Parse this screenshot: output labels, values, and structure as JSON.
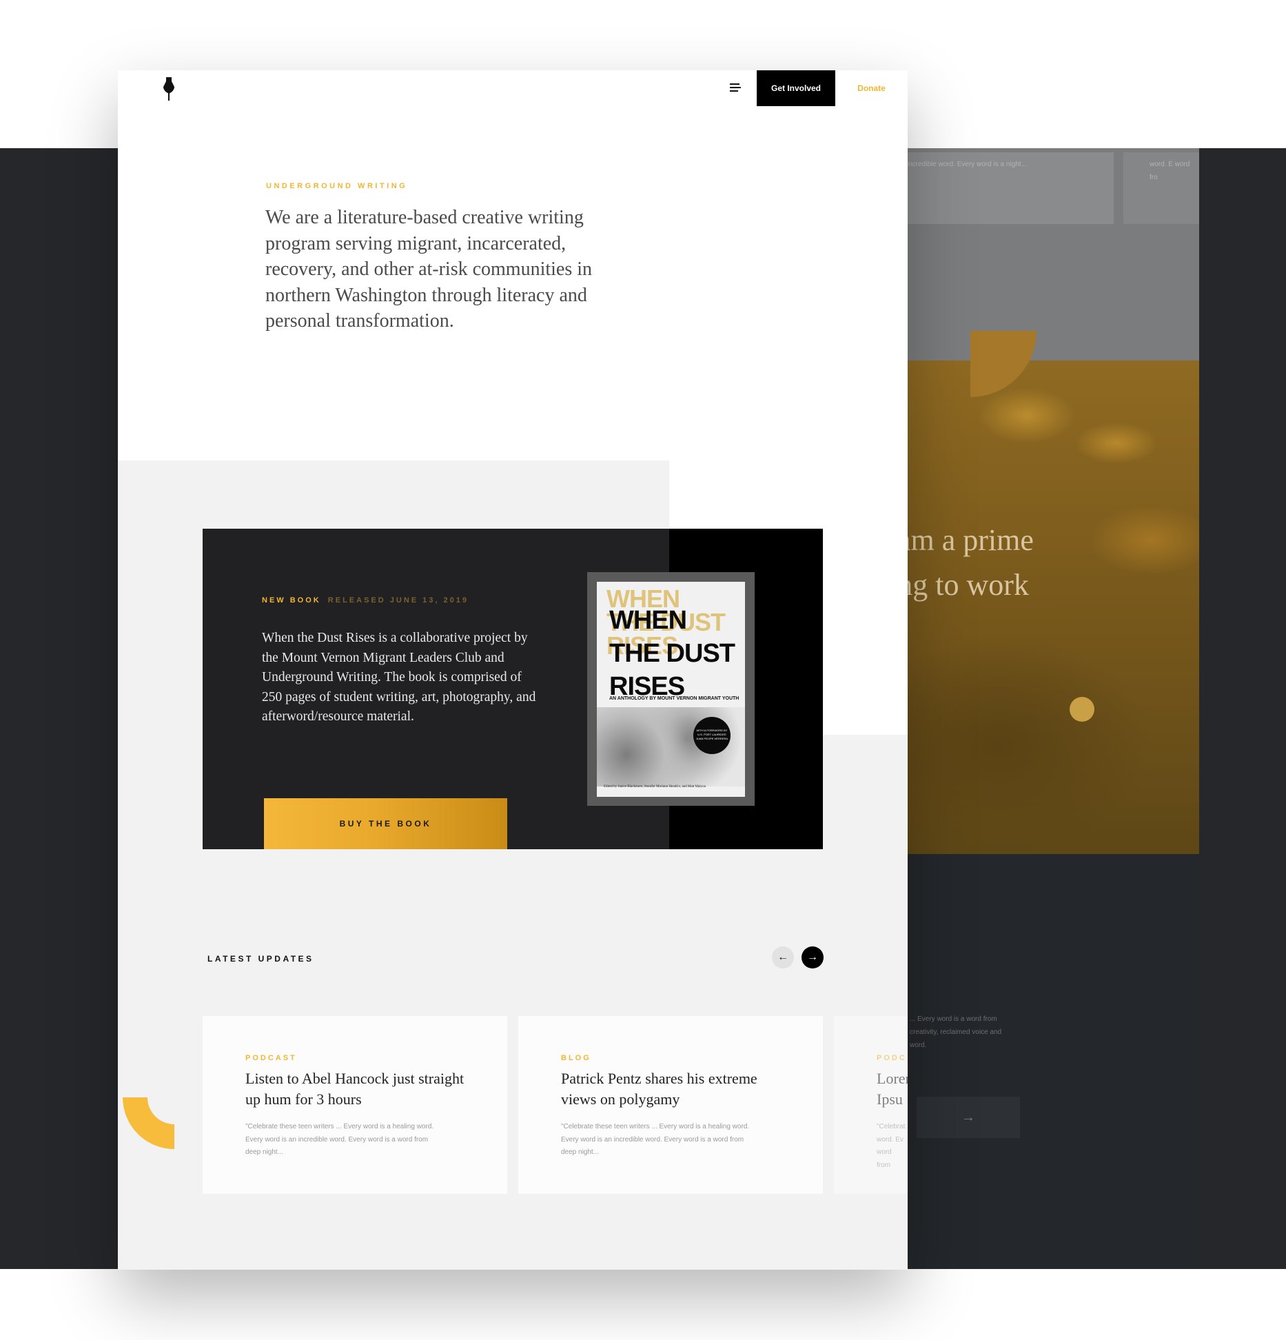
{
  "nav": {
    "get_involved": "Get Involved",
    "donate": "Donate"
  },
  "hero": {
    "eyebrow": "UNDERGROUND WRITING",
    "intro": "We are a literature-based creative writing program serving migrant, incarcerated, recovery, and other at-risk communities in northern Washington through literacy and personal transformation."
  },
  "book": {
    "label_new": "NEW BOOK",
    "label_released": "RELEASED JUNE 13, 2019",
    "description": "When the Dust Rises is a collaborative project by the Mount Vernon Migrant Leaders Club and Underground Writing. The book is comprised of 250 pages of student writing, art, photography, and afterword/resource material.",
    "buy_label": "BUY THE BOOK",
    "cover": {
      "title_lines": [
        "WHEN",
        "THE DUST",
        "RISES"
      ],
      "ghost_lines": [
        "WHEN",
        "THE DUST",
        "RISES"
      ],
      "subtitle": "AN ANTHOLOGY BY MOUNT VERNON MIGRANT YOUTH",
      "badge_text": "WITH A FOREWORD BY U.S. POET LAUREATE JUAN FELIPE HERRERA",
      "editors": "Edited by Janice Blackmore, Jennifer Moriano Hendrix, and Matt Malyon"
    }
  },
  "updates": {
    "title": "LATEST UPDATES",
    "prev_icon": "←",
    "next_icon": "→",
    "cards": [
      {
        "tag": "PODCAST",
        "title": "Listen to Abel Hancock just straight up hum for 3 hours",
        "excerpt": "\"Celebrate these teen writers ... Every word is a healing word.  Every word is an incredible word. Every word is a word from deep night..."
      },
      {
        "tag": "BLOG",
        "title": "Patrick Pentz shares his extreme views on polygamy",
        "excerpt": "\"Celebrate these teen writers ... Every word is a healing word.  Every word is an incredible word. Every word is a word from deep night..."
      },
      {
        "tag": "PODC",
        "title": "Lorem Ipsu",
        "excerpt": "\"Celebrat word.  Ev word from"
      }
    ]
  },
  "back_page": {
    "top_card_text": "is an incredible word. Every word is a night...",
    "top_card2_text": "word.  E word fro",
    "big_quote_line1": "am a prime",
    "big_quote_line2": "ing to work",
    "small_text": "... Every word is a word from creativity, reclaimed voice and word.",
    "cta_icon": "→"
  },
  "colors": {
    "accent": "#f2b632",
    "dark": "#212123",
    "background_band": "#25272a",
    "panel_gray": "#f2f2f2"
  },
  "icons": {
    "logo": "fountain-pen-nib-icon",
    "menu": "hamburger-menu-icon"
  }
}
